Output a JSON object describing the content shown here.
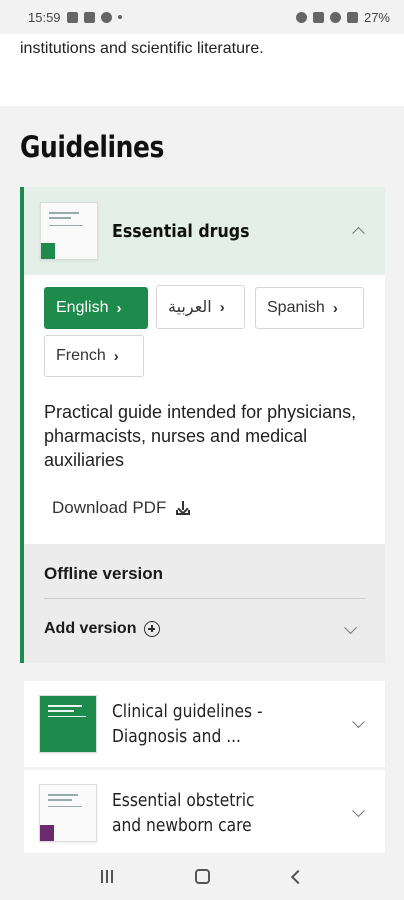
{
  "status_bar": {
    "time": "15:59",
    "battery": "27%"
  },
  "intro": {
    "text": "institutions and scientific literature."
  },
  "section": {
    "title": "Guidelines"
  },
  "expanded_guide": {
    "title": "Essential drugs",
    "languages": [
      {
        "label": "English",
        "active": true
      },
      {
        "label": "العربية",
        "active": false
      },
      {
        "label": "Spanish",
        "active": false
      },
      {
        "label": "French",
        "active": false
      }
    ],
    "description": "Practical guide intended for physicians, pharmacists, nurses and medical auxiliaries",
    "download_label": "Download PDF",
    "offline": {
      "title": "Offline version",
      "add_label": "Add version"
    }
  },
  "guides": [
    {
      "title_line1": "Clinical guidelines -",
      "title_line2": "Diagnosis and ..."
    },
    {
      "title_line1": "Essential obstetric",
      "title_line2": "and newborn care"
    }
  ],
  "colors": {
    "accent": "#1e8a4c",
    "header_bg": "#e3efe8",
    "offline_bg": "#ececec"
  }
}
